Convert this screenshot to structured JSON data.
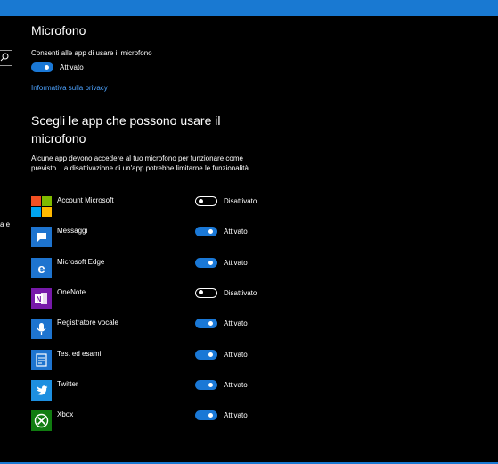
{
  "header": {
    "title": "Microfono"
  },
  "global_access": {
    "label": "Consenti alle app di usare il microfono",
    "toggle_on": true,
    "state_label": "Attivato"
  },
  "privacy_link": "Informativa sulla privacy",
  "apps_section": {
    "title": "Scegli le app che possono usare il microfono",
    "description": "Alcune app devono accedere al tuo microfono per funzionare come previsto. La disattivazione di un'app potrebbe limitarne le funzionalità."
  },
  "sidebar": {
    "fragment_text": "a e",
    "search_icon": "search-icon"
  },
  "apps": [
    {
      "name": "Account Microsoft",
      "icon": "microsoft-logo-icon",
      "on": false,
      "state": "Disattivato",
      "color": "#0078d7"
    },
    {
      "name": "Messaggi",
      "icon": "messaging-icon",
      "on": true,
      "state": "Attivato",
      "color": "#1e74cf"
    },
    {
      "name": "Microsoft Edge",
      "icon": "edge-icon",
      "on": true,
      "state": "Attivato",
      "color": "#1e74cf"
    },
    {
      "name": "OneNote",
      "icon": "onenote-icon",
      "on": false,
      "state": "Disattivato",
      "color": "#7719aa"
    },
    {
      "name": "Registratore vocale",
      "icon": "voice-recorder-icon",
      "on": true,
      "state": "Attivato",
      "color": "#1e74cf"
    },
    {
      "name": "Test ed esami",
      "icon": "test-exams-icon",
      "on": true,
      "state": "Attivato",
      "color": "#1e74cf"
    },
    {
      "name": "Twitter",
      "icon": "twitter-icon",
      "on": true,
      "state": "Attivato",
      "color": "#1d8fe0"
    },
    {
      "name": "Xbox",
      "icon": "xbox-icon",
      "on": true,
      "state": "Attivato",
      "color": "#107c10"
    }
  ],
  "colors": {
    "accent": "#1a78d6",
    "link": "#4da3ff",
    "background": "#000000"
  }
}
